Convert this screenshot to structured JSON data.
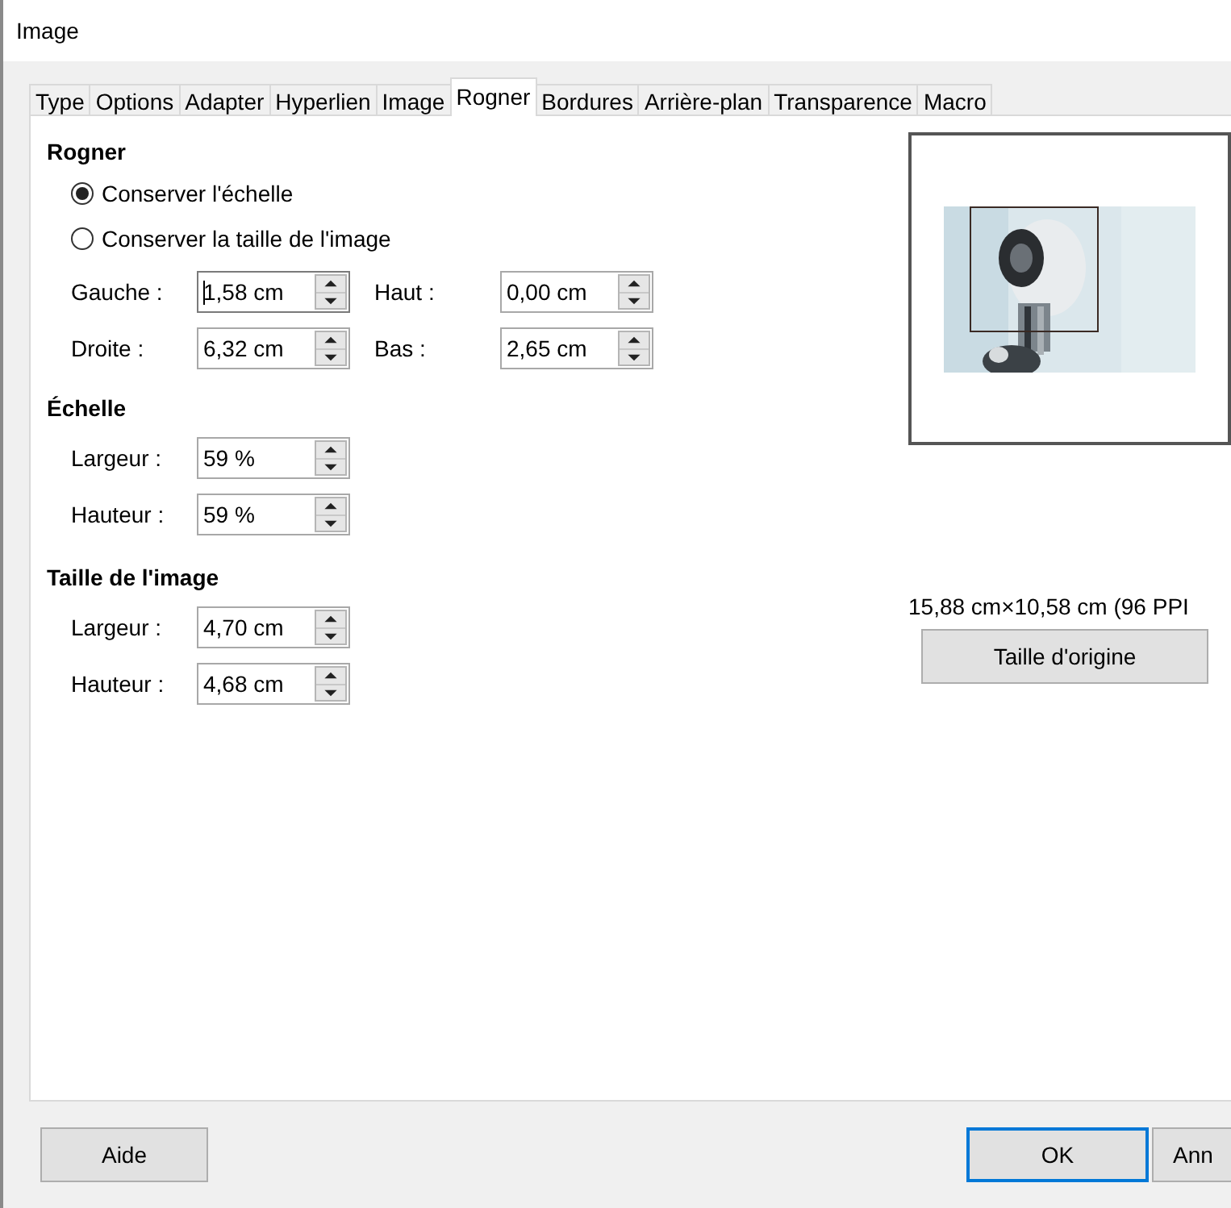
{
  "window": {
    "title": "Image"
  },
  "tabs": [
    {
      "label": "Type",
      "selected": false
    },
    {
      "label": "Options",
      "selected": false
    },
    {
      "label": "Adapter",
      "selected": false
    },
    {
      "label": "Hyperlien",
      "selected": false
    },
    {
      "label": "Image",
      "selected": false
    },
    {
      "label": "Rogner",
      "selected": true
    },
    {
      "label": "Bordures",
      "selected": false
    },
    {
      "label": "Arrière-plan",
      "selected": false
    },
    {
      "label": "Transparence",
      "selected": false
    },
    {
      "label": "Macro",
      "selected": false
    }
  ],
  "crop": {
    "heading": "Rogner",
    "options": [
      {
        "label": "Conserver l'échelle",
        "selected": true
      },
      {
        "label": "Conserver la taille de l'image",
        "selected": false
      }
    ],
    "fields": [
      {
        "label": "Gauche :",
        "value": "1,58 cm",
        "focused": true
      },
      {
        "label": "Haut :",
        "value": "0,00 cm",
        "focused": false
      },
      {
        "label": "Droite :",
        "value": "6,32 cm",
        "focused": false
      },
      {
        "label": "Bas :",
        "value": "2,65 cm",
        "focused": false
      }
    ]
  },
  "scale": {
    "heading": "Échelle",
    "fields": [
      {
        "label": "Largeur :",
        "value": "59 %",
        "focused": false
      },
      {
        "label": "Hauteur :",
        "value": "59 %",
        "focused": false
      }
    ]
  },
  "image_size": {
    "heading": "Taille de l'image",
    "fields": [
      {
        "label": "Largeur :",
        "value": "4,70 cm",
        "focused": false
      },
      {
        "label": "Hauteur :",
        "value": "4,68 cm",
        "focused": false
      }
    ]
  },
  "preview": {
    "original_size": "15,88 cm×10,58 cm (96 PPI",
    "button": "Taille d'origine"
  },
  "buttons": [
    {
      "label": "Aide",
      "default": false
    },
    {
      "label": "OK",
      "default": true
    },
    {
      "label": "Ann",
      "default": false
    }
  ]
}
